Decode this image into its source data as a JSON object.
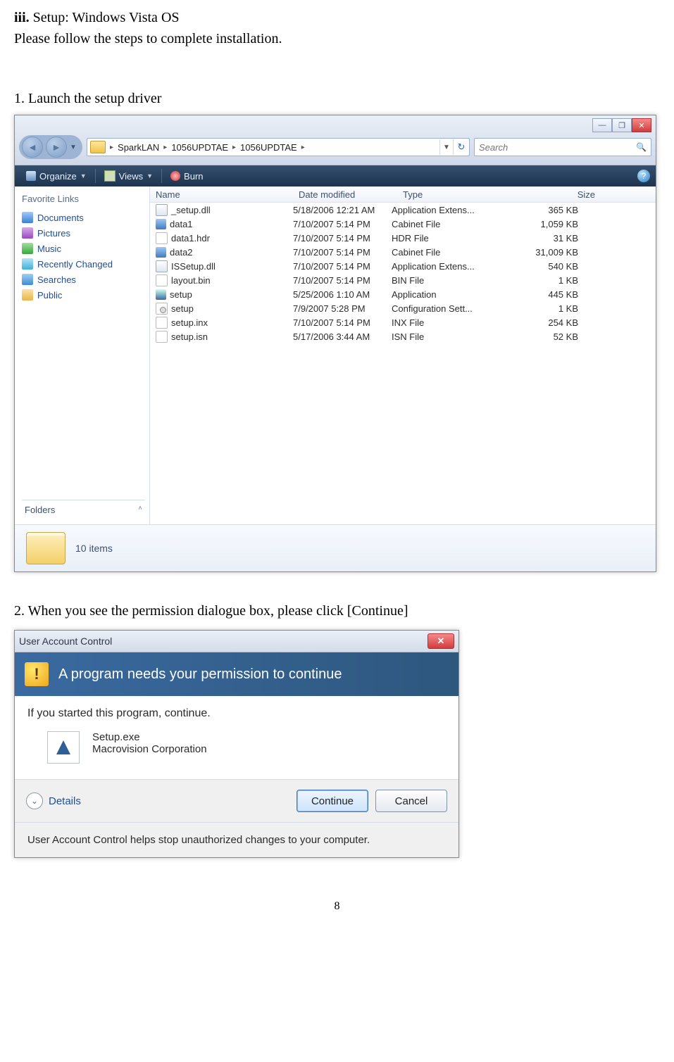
{
  "doc": {
    "heading_prefix": "iii.",
    "heading_rest": " Setup: Windows Vista OS",
    "intro": "Please follow the steps to complete installation.",
    "step1": "1. Launch the setup driver",
    "step2": "2. When you see the permission dialogue box, please click [Continue]",
    "page_num": "8"
  },
  "explorer": {
    "breadcrumbs": [
      "SparkLAN",
      "1056UPDTAE",
      "1056UPDTAE"
    ],
    "search_placeholder": "Search",
    "toolbar": {
      "organize": "Organize",
      "views": "Views",
      "burn": "Burn"
    },
    "fav_header": "Favorite Links",
    "fav_items": [
      "Documents",
      "Pictures",
      "Music",
      "Recently Changed",
      "Searches",
      "Public"
    ],
    "folders_label": "Folders",
    "columns": {
      "name": "Name",
      "date": "Date modified",
      "type": "Type",
      "size": "Size"
    },
    "files": [
      {
        "icon": "dll",
        "name": "_setup.dll",
        "date": "5/18/2006 12:21 AM",
        "type": "Application Extens...",
        "size": "365 KB"
      },
      {
        "icon": "cab",
        "name": "data1",
        "date": "7/10/2007 5:14 PM",
        "type": "Cabinet File",
        "size": "1,059 KB"
      },
      {
        "icon": "file",
        "name": "data1.hdr",
        "date": "7/10/2007 5:14 PM",
        "type": "HDR File",
        "size": "31 KB"
      },
      {
        "icon": "cab",
        "name": "data2",
        "date": "7/10/2007 5:14 PM",
        "type": "Cabinet File",
        "size": "31,009 KB"
      },
      {
        "icon": "dll",
        "name": "ISSetup.dll",
        "date": "7/10/2007 5:14 PM",
        "type": "Application Extens...",
        "size": "540 KB"
      },
      {
        "icon": "file",
        "name": "layout.bin",
        "date": "7/10/2007 5:14 PM",
        "type": "BIN File",
        "size": "1 KB"
      },
      {
        "icon": "exe",
        "name": "setup",
        "date": "5/25/2006 1:10 AM",
        "type": "Application",
        "size": "445 KB"
      },
      {
        "icon": "ini",
        "name": "setup",
        "date": "7/9/2007 5:28 PM",
        "type": "Configuration Sett...",
        "size": "1 KB"
      },
      {
        "icon": "file",
        "name": "setup.inx",
        "date": "7/10/2007 5:14 PM",
        "type": "INX File",
        "size": "254 KB"
      },
      {
        "icon": "file",
        "name": "setup.isn",
        "date": "5/17/2006 3:44 AM",
        "type": "ISN File",
        "size": "52 KB"
      }
    ],
    "status": "10 items"
  },
  "uac": {
    "title": "User Account Control",
    "banner": "A program needs your permission to continue",
    "if_started": "If you started this program, continue.",
    "prog_name": "Setup.exe",
    "prog_company": "Macrovision Corporation",
    "details": "Details",
    "continue": "Continue",
    "cancel": "Cancel",
    "footer": "User Account Control helps stop unauthorized changes to your computer."
  }
}
